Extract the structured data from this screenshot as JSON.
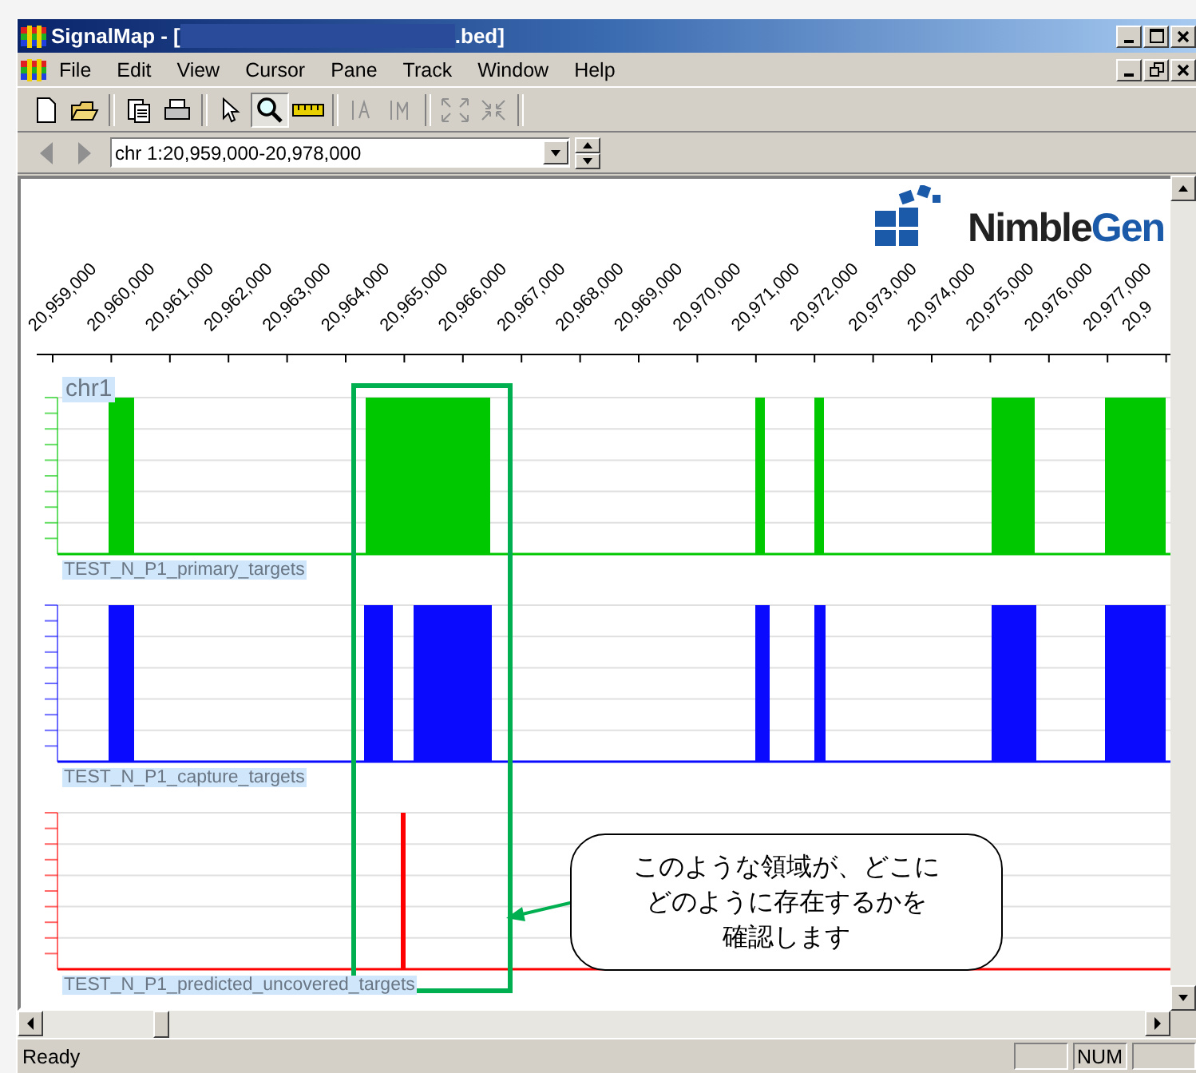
{
  "window": {
    "title_prefix": "SignalMap - [",
    "title_suffix": ".bed]"
  },
  "menu": [
    {
      "label": "File"
    },
    {
      "label": "Edit"
    },
    {
      "label": "View"
    },
    {
      "label": "Cursor"
    },
    {
      "label": "Pane"
    },
    {
      "label": "Track"
    },
    {
      "label": "Window"
    },
    {
      "label": "Help"
    }
  ],
  "locator": {
    "value": "chr 1:20,959,000-20,978,000"
  },
  "logo": {
    "parts": [
      "Nimble",
      "Gen"
    ]
  },
  "axis": {
    "ticks": [
      "20,959,000",
      "20,960,000",
      "20,961,000",
      "20,962,000",
      "20,963,000",
      "20,964,000",
      "20,965,000",
      "20,966,000",
      "20,967,000",
      "20,968,000",
      "20,969,000",
      "20,970,000",
      "20,971,000",
      "20,972,000",
      "20,973,000",
      "20,974,000",
      "20,975,000",
      "20,976,000",
      "20,977,000",
      "20,9"
    ]
  },
  "chromosome": "chr1",
  "tracks": [
    {
      "name": "TEST_N_P1_primary_targets",
      "color": "#00c800"
    },
    {
      "name": "TEST_N_P1_capture_targets",
      "color": "#0a0aff"
    },
    {
      "name": "TEST_N_P1_predicted_uncovered_targets",
      "color": "#ff0000"
    }
  ],
  "callout": {
    "lines": [
      "このような領域が、どこに",
      "どのように存在するかを",
      "確認します"
    ]
  },
  "status_bar": {
    "text": "Ready",
    "indicators": [
      {
        "label": "NUM"
      }
    ]
  }
}
